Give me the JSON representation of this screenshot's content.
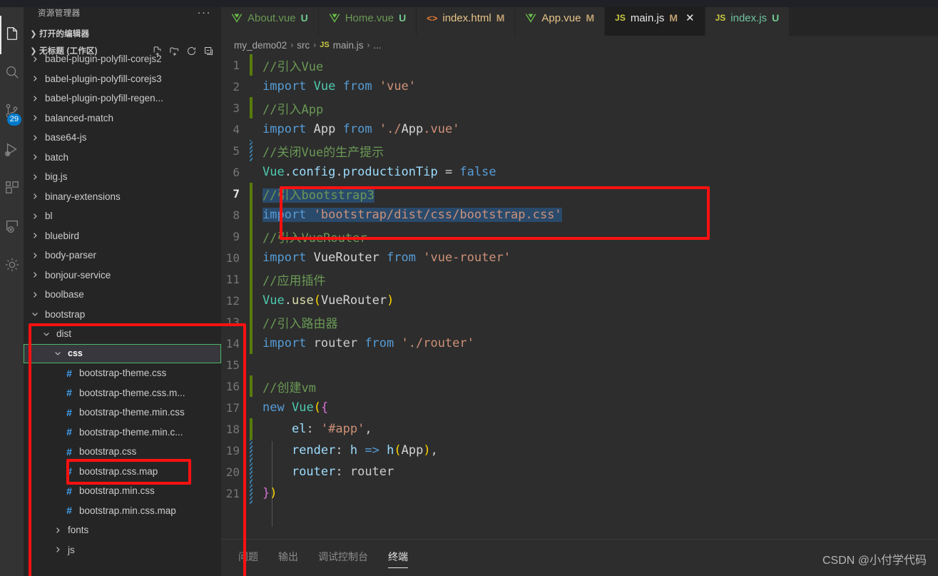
{
  "activitybar": {
    "items": [
      {
        "name": "explorer",
        "icon": "files-icon",
        "active": true,
        "badge": ""
      },
      {
        "name": "search",
        "icon": "search-icon",
        "active": false,
        "badge": ""
      },
      {
        "name": "source-control",
        "icon": "source-control-icon",
        "active": false,
        "badge": "29"
      },
      {
        "name": "run-and-debug",
        "icon": "run-debug-icon",
        "active": false,
        "badge": ""
      },
      {
        "name": "extensions",
        "icon": "extensions-icon",
        "active": false,
        "badge": ""
      },
      {
        "name": "remote-explorer",
        "icon": "remote-icon",
        "active": false,
        "badge": ""
      },
      {
        "name": "settings-gear",
        "icon": "gear-icon",
        "active": false,
        "badge": ""
      }
    ]
  },
  "sidebar": {
    "title": "资源管理器",
    "more_label": "···",
    "open_editors_label": "打开的编辑器",
    "workspace_label": "无标题 (工作区)",
    "tree": [
      {
        "label": "babel-plugin-polyfill-corejs2",
        "depth": 1,
        "type": "folder",
        "expanded": false,
        "clipped": true
      },
      {
        "label": "babel-plugin-polyfill-corejs3",
        "depth": 1,
        "type": "folder",
        "expanded": false
      },
      {
        "label": "babel-plugin-polyfill-regen...",
        "depth": 1,
        "type": "folder",
        "expanded": false
      },
      {
        "label": "balanced-match",
        "depth": 1,
        "type": "folder",
        "expanded": false
      },
      {
        "label": "base64-js",
        "depth": 1,
        "type": "folder",
        "expanded": false
      },
      {
        "label": "batch",
        "depth": 1,
        "type": "folder",
        "expanded": false
      },
      {
        "label": "big.js",
        "depth": 1,
        "type": "folder",
        "expanded": false
      },
      {
        "label": "binary-extensions",
        "depth": 1,
        "type": "folder",
        "expanded": false
      },
      {
        "label": "bl",
        "depth": 1,
        "type": "folder",
        "expanded": false
      },
      {
        "label": "bluebird",
        "depth": 1,
        "type": "folder",
        "expanded": false
      },
      {
        "label": "body-parser",
        "depth": 1,
        "type": "folder",
        "expanded": false
      },
      {
        "label": "bonjour-service",
        "depth": 1,
        "type": "folder",
        "expanded": false
      },
      {
        "label": "boolbase",
        "depth": 1,
        "type": "folder",
        "expanded": false
      },
      {
        "label": "bootstrap",
        "depth": 1,
        "type": "folder",
        "expanded": true
      },
      {
        "label": "dist",
        "depth": 2,
        "type": "folder",
        "expanded": true
      },
      {
        "label": "css",
        "depth": 3,
        "type": "folder",
        "expanded": true,
        "selected": true,
        "focused": true
      },
      {
        "label": "bootstrap-theme.css",
        "depth": 4,
        "type": "file-css"
      },
      {
        "label": "bootstrap-theme.css.m...",
        "depth": 4,
        "type": "file-css"
      },
      {
        "label": "bootstrap-theme.min.css",
        "depth": 4,
        "type": "file-css"
      },
      {
        "label": "bootstrap-theme.min.c...",
        "depth": 4,
        "type": "file-css"
      },
      {
        "label": "bootstrap.css",
        "depth": 4,
        "type": "file-css",
        "annotated": true
      },
      {
        "label": "bootstrap.css.map",
        "depth": 4,
        "type": "file-css"
      },
      {
        "label": "bootstrap.min.css",
        "depth": 4,
        "type": "file-css"
      },
      {
        "label": "bootstrap.min.css.map",
        "depth": 4,
        "type": "file-css"
      },
      {
        "label": "fonts",
        "depth": 3,
        "type": "folder",
        "expanded": false
      },
      {
        "label": "js",
        "depth": 3,
        "type": "folder",
        "expanded": false,
        "clipped": true
      }
    ]
  },
  "tabs": [
    {
      "label": "About.vue",
      "badge": "U",
      "badge_kind": "untracked",
      "icon": "vue-icon",
      "active": false,
      "closable": false
    },
    {
      "label": "Home.vue",
      "badge": "U",
      "badge_kind": "untracked",
      "icon": "vue-icon",
      "active": false,
      "closable": false
    },
    {
      "label": "index.html",
      "badge": "M",
      "badge_kind": "modified",
      "icon": "html-icon",
      "active": false,
      "closable": false
    },
    {
      "label": "App.vue",
      "badge": "M",
      "badge_kind": "modified",
      "icon": "vue-icon",
      "active": false,
      "closable": false
    },
    {
      "label": "main.js",
      "badge": "M",
      "badge_kind": "modified",
      "icon": "js-icon",
      "active": true,
      "closable": true,
      "close_label": "✕"
    },
    {
      "label": "index.js",
      "badge": "U",
      "badge_kind": "untracked",
      "icon": "js-icon",
      "active": false,
      "closable": false
    }
  ],
  "breadcrumbs": {
    "items": [
      "my_demo02",
      "src",
      "main.js",
      "..."
    ],
    "file_icon": "js-icon",
    "separator": "›"
  },
  "editor": {
    "active_line": 7,
    "lines": [
      {
        "n": 1,
        "gutter": "added",
        "text": "//引入Vue"
      },
      {
        "n": 2,
        "gutter": "none",
        "text": "import Vue from 'vue'"
      },
      {
        "n": 3,
        "gutter": "added",
        "text": "//引入App"
      },
      {
        "n": 4,
        "gutter": "none",
        "text": "import App from './App.vue'"
      },
      {
        "n": 5,
        "gutter": "modified",
        "text": "//关闭Vue的生产提示"
      },
      {
        "n": 6,
        "gutter": "none",
        "text": "Vue.config.productionTip = false"
      },
      {
        "n": 7,
        "gutter": "added",
        "text": "//引入bootstrap3",
        "selected": true
      },
      {
        "n": 8,
        "gutter": "added",
        "text": "import 'bootstrap/dist/css/bootstrap.css'",
        "selected": true
      },
      {
        "n": 9,
        "gutter": "added",
        "text": "//引入VueRouter"
      },
      {
        "n": 10,
        "gutter": "added",
        "text": "import VueRouter from 'vue-router'"
      },
      {
        "n": 11,
        "gutter": "added",
        "text": "//应用插件"
      },
      {
        "n": 12,
        "gutter": "added",
        "text": "Vue.use(VueRouter)"
      },
      {
        "n": 13,
        "gutter": "added",
        "text": "//引入路由器"
      },
      {
        "n": 14,
        "gutter": "added",
        "text": "import router from './router'"
      },
      {
        "n": 15,
        "gutter": "none",
        "text": ""
      },
      {
        "n": 16,
        "gutter": "added",
        "text": "//创建vm"
      },
      {
        "n": 17,
        "gutter": "none",
        "text": "new Vue({"
      },
      {
        "n": 18,
        "gutter": "added",
        "text": "    el: '#app',"
      },
      {
        "n": 19,
        "gutter": "modified",
        "text": "    render: h => h(App),"
      },
      {
        "n": 20,
        "gutter": "modified",
        "text": "    router: router"
      },
      {
        "n": 21,
        "gutter": "modified",
        "text": "})"
      }
    ]
  },
  "panel": {
    "tabs": [
      {
        "label": "问题",
        "active": false
      },
      {
        "label": "输出",
        "active": false
      },
      {
        "label": "调试控制台",
        "active": false
      },
      {
        "label": "终端",
        "active": true
      }
    ]
  },
  "watermark": "CSDN @小付学代码",
  "colors": {
    "accent": "#007acc",
    "annotation_red": "#ff1111",
    "focus_green": "#4bb866",
    "gutter_added": "#587c0c",
    "gutter_modified": "#3a7ca8",
    "selection": "#2a4a6b",
    "editor_bg": "#2d2d2d",
    "sidebar_bg": "#252526",
    "activitybar_bg": "#333333",
    "tab_active_bg": "#1e1e1e"
  }
}
